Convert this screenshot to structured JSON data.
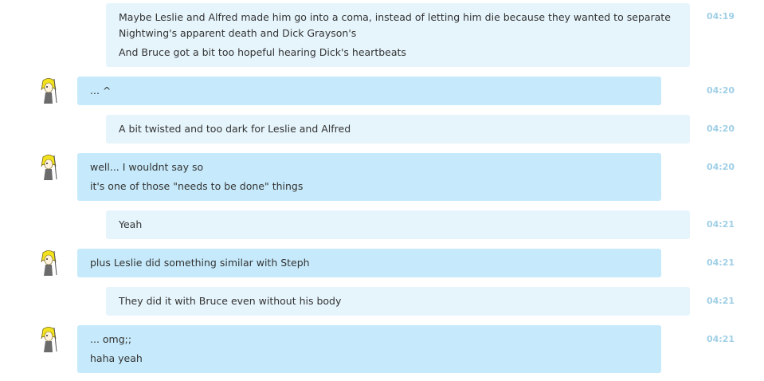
{
  "messages": [
    {
      "sender": "me",
      "time": "04:19",
      "lines": [
        "Maybe Leslie and Alfred made him go into a coma, instead of letting him die because they wanted to separate",
        "Nightwing's apparent death and Dick Grayson's",
        "And Bruce got a bit too hopeful hearing Dick's heartbeats"
      ]
    },
    {
      "sender": "them",
      "time": "04:20",
      "lines": [
        "... ^"
      ]
    },
    {
      "sender": "me",
      "time": "04:20",
      "lines": [
        "A bit twisted and too dark for Leslie and Alfred"
      ]
    },
    {
      "sender": "them",
      "time": "04:20",
      "lines": [
        "well... I wouldnt say so",
        "it's one of those \"needs to be done\" things"
      ]
    },
    {
      "sender": "me",
      "time": "04:21",
      "lines": [
        "Yeah"
      ]
    },
    {
      "sender": "them",
      "time": "04:21",
      "lines": [
        "plus Leslie did something similar with Steph"
      ]
    },
    {
      "sender": "me",
      "time": "04:21",
      "lines": [
        "They did it with Bruce even without his body"
      ]
    },
    {
      "sender": "them",
      "time": "04:21",
      "lines": [
        "... omg;;",
        "haha yeah"
      ]
    }
  ],
  "avatar_icon": "anime-character-avatar-icon"
}
